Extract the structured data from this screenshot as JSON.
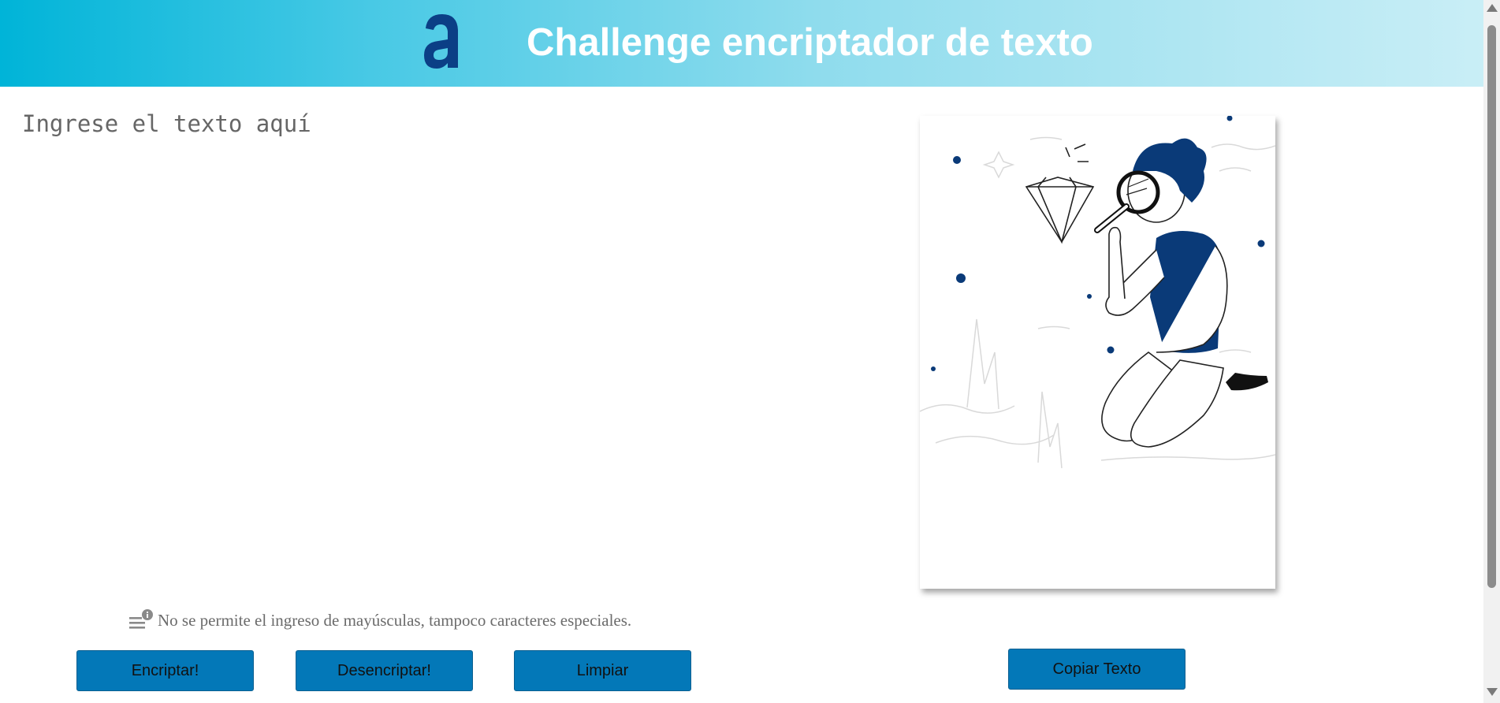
{
  "header": {
    "logo_icon": "alura-a-logo-icon",
    "title": "Challenge encriptador de texto",
    "gradient_start": "#00b4d8",
    "gradient_end": "#c9eef6"
  },
  "main": {
    "input_value": "",
    "input_placeholder": "Ingrese el texto aquí",
    "hint_icon": "info-list-icon",
    "hint_text": "No se permite el ingreso de mayúsculas, tampoco caracteres especiales."
  },
  "actions": {
    "encrypt_label": "Encriptar!",
    "decrypt_label": "Desencriptar!",
    "clear_label": "Limpiar",
    "copy_label": "Copiar Texto",
    "button_color": "#0378b8"
  },
  "output": {
    "illustration": "person-with-magnifying-glass-diamond-illustration",
    "accent_color": "#0a3a78"
  }
}
